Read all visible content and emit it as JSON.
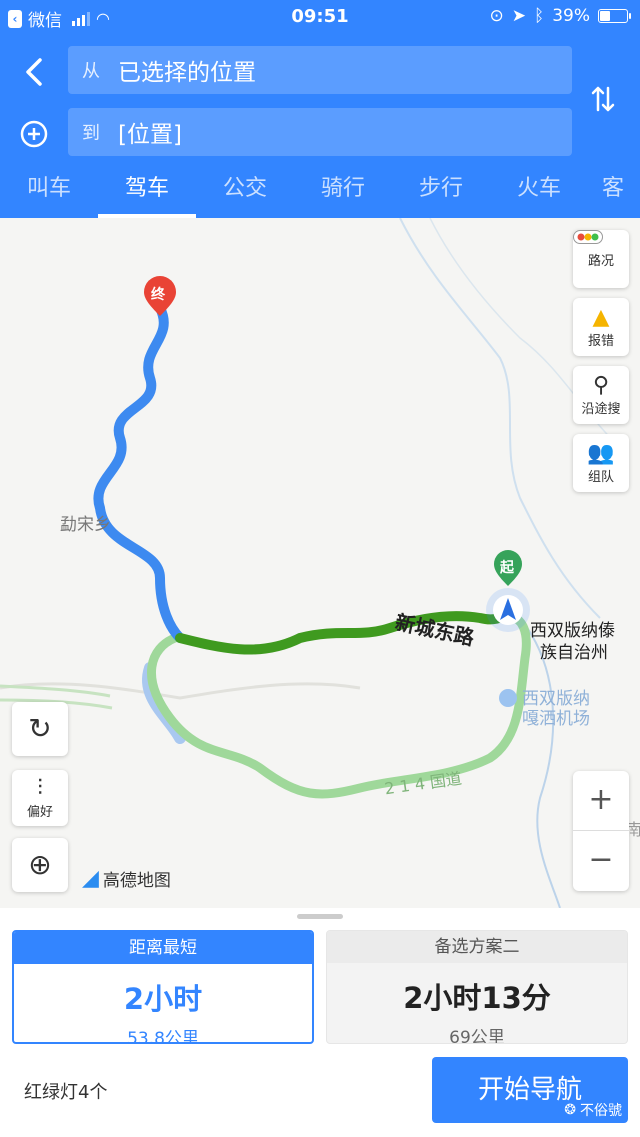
{
  "status_bar": {
    "back_app": "微信",
    "time": "09:51",
    "battery": "39%",
    "battery_level": 0.39
  },
  "route_inputs": {
    "from_prefix": "从",
    "from_value": "已选择的位置",
    "to_prefix": "到",
    "to_value": "[位置]"
  },
  "tabs": [
    "叫车",
    "驾车",
    "公交",
    "骑行",
    "步行",
    "火车",
    "客"
  ],
  "active_tab": "驾车",
  "map": {
    "tools": {
      "traffic": "路况",
      "report": "报错",
      "search_along": "沿途搜",
      "team": "组队"
    },
    "preference": "偏好",
    "logo": "高德地图",
    "end_marker": "终",
    "start_marker": "起",
    "labels": {
      "township": "勐宋乡",
      "road": "新城东路",
      "prefecture_line1": "西双版纳傣",
      "prefecture_line2": "族自治州",
      "airport_line1": "西双版纳",
      "airport_line2": "嘎洒机场",
      "highway": "2 1 4 国道",
      "edge_text": "南"
    },
    "zoom_in": "+",
    "zoom_out": "−"
  },
  "routes": [
    {
      "label": "距离最短",
      "duration": "2小时",
      "distance": "53.8公里",
      "selected": true
    },
    {
      "label": "备选方案二",
      "duration": "2小时13分",
      "distance": "69公里",
      "selected": false
    }
  ],
  "traffic_lights": "红绿灯4个",
  "start_navigation": "开始导航",
  "watermark": "不俗號",
  "colors": {
    "primary": "#3385ff",
    "route_blue": "#3d8af0",
    "route_green": "#3f9a1f",
    "route_alt": "#9fd89a"
  }
}
